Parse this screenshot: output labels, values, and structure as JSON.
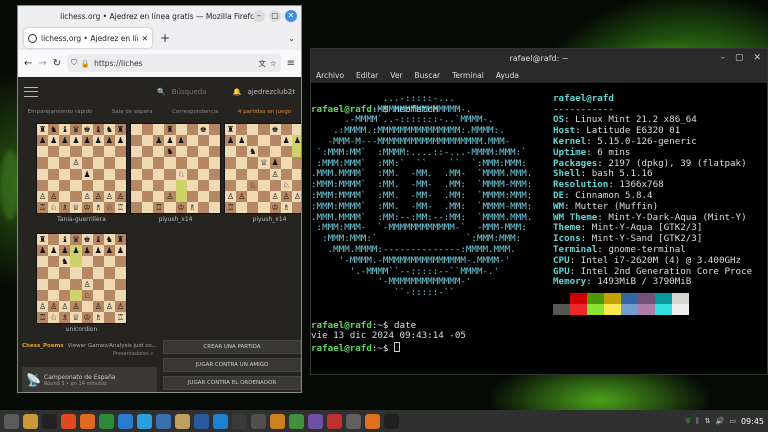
{
  "firefox": {
    "window_title": "lichess.org • Ajedrez en línea gratis — Mozilla Firefox",
    "tab_title": "lichess.org • Ajedrez en líne",
    "new_tab": "+",
    "url": "https://liches",
    "lichess": {
      "search_placeholder": "Búsqueda",
      "username": "ajedrezclub2t",
      "nav": [
        "Emparejamiento rápido",
        "Sala de espera",
        "Correspondencia",
        "4 partidas en juego"
      ],
      "boards": [
        {
          "name": "Tania-guerrillera",
          "position": [
            "rnbqkbnr",
            "pppppppp",
            "........",
            "...P....",
            "....p...",
            "........",
            "PP..PPPP",
            "RNBQKBNR"
          ],
          "highlights": []
        },
        {
          "name": "piyush_x14",
          "position": [
            "...r..k.",
            "..ppp...",
            "...n....",
            "........",
            "....N...",
            "........",
            "...P....",
            "..R.KB.."
          ],
          "highlights": [
            "5,4",
            "6,4"
          ]
        },
        {
          "name": "piyush_x14",
          "position": [
            "r...k..r",
            "pp...ppp",
            "..n.....",
            "...Qp...",
            "....P...",
            "..N..N..",
            "PP..PPPP",
            "R...KB.R"
          ],
          "highlights": [
            "1,6",
            "2,6"
          ]
        },
        {
          "name": "unicordion",
          "position": [
            "r.bqkbnr",
            "pppppppp",
            "..n.....",
            "........",
            "....P...",
            "....N...",
            "PPPP.PPP",
            "RNBQKB.R"
          ],
          "highlights": [
            "1,3",
            "2,3",
            "5,3"
          ]
        }
      ],
      "streamer": "Chess_Poems",
      "streamer_status": "Viewer Games/Analysis just co...",
      "presentadores": "Presentadores »",
      "buttons": [
        "CREAR UNA PARTIDA",
        "JUGAR CONTRA UN AMIGO",
        "JUGAR CONTRA EL ORDENADOR"
      ],
      "tournament_name": "Campeonato de España",
      "tournament_round": "Round 3 • en 14 minutos"
    }
  },
  "terminal": {
    "title": "rafael@rafd: ~",
    "menu": [
      "Archivo",
      "Editar",
      "Ver",
      "Buscar",
      "Terminal",
      "Ayuda"
    ],
    "prompt": "rafael@rafd",
    "prompt_suffix": ":~$ ",
    "cmd1": "neofetch",
    "logo_lines": [
      "             ...-:::::-...",
      "          .-MMMMMMMMMMMMMMM-.",
      "      .-MMMM`..-:::::::-..`MMMM-.",
      "    .:MMMM.:MMMMMMMMMMMMMMM:.MMMM:.",
      "   -MMM-M---MMMMMMMMMMMMMMMMMMM.MMM-",
      " `:MMM:MM`  :MMMM:....::-...-MMMM:MMM:`",
      " :MMM:MMM`  :MM:`  ``    ``  `:MMM:MMM:",
      ".MMM.MMMM`  :MM.  -MM.  .MM-  `MMMM.MMM.",
      ":MMM:MMMM`  :MM.  -MM-  .MM:  `MMMM-MMM:",
      ":MMM:MMMM`  :MM.  -MM-  .MM:  `MMMM:MMM:",
      ":MMM:MMMM`  :MM.  -MM-  .MM:  `MMMM-MMM:",
      ".MMM.MMMM`  :MM:--:MM:--:MM:  `MMMM.MMM.",
      " :MMM:MMM-  `-MMMMMMMMMMMM-`  -MMM-MMM:",
      "  :MMM:MMM:`                `:MMM:MMM:",
      "   .MMM.MMMM:--------------:MMMM.MMM.",
      "     '-MMMM.-MMMMMMMMMMMMMMM-.MMMM-'",
      "       '.-MMMM``--:::::--``MMMM-.'",
      "            '-MMMMMMMMMMMMM-'",
      "               ``-:::::-``"
    ],
    "header": "rafael@rafd",
    "separator": "-----------",
    "info": [
      {
        "k": "OS",
        "v": "Linux Mint 21.2 x86_64"
      },
      {
        "k": "Host",
        "v": "Latitude E6320 01"
      },
      {
        "k": "Kernel",
        "v": "5.15.0-126-generic"
      },
      {
        "k": "Uptime",
        "v": "6 mins"
      },
      {
        "k": "Packages",
        "v": "2197 (dpkg), 39 (flatpak)"
      },
      {
        "k": "Shell",
        "v": "bash 5.1.16"
      },
      {
        "k": "Resolution",
        "v": "1366x768"
      },
      {
        "k": "DE",
        "v": "Cinnamon 5.8.4"
      },
      {
        "k": "WM",
        "v": "Mutter (Muffin)"
      },
      {
        "k": "WM Theme",
        "v": "Mint-Y-Dark-Aqua (Mint-Y)"
      },
      {
        "k": "Theme",
        "v": "Mint-Y-Aqua [GTK2/3]"
      },
      {
        "k": "Icons",
        "v": "Mint-Y-Sand [GTK2/3]"
      },
      {
        "k": "Terminal",
        "v": "gnome-terminal"
      },
      {
        "k": "CPU",
        "v": "Intel i7-2620M (4) @ 3.400GHz"
      },
      {
        "k": "GPU",
        "v": "Intel 2nd Generation Core Proce"
      },
      {
        "k": "Memory",
        "v": "1493MiB / 3790MiB"
      }
    ],
    "palette": [
      "#000000",
      "#cc0000",
      "#4e9a06",
      "#c4a000",
      "#3465a4",
      "#75507b",
      "#06989a",
      "#d3d7cf",
      "#555753",
      "#ef2929",
      "#8ae234",
      "#fce94f",
      "#729fcf",
      "#ad7fa8",
      "#34e2e2",
      "#eeeeec"
    ],
    "cmd2": "date",
    "date_output": "vie 13 dic 2024 09:43:14 -05"
  },
  "taskbar": {
    "clock": "09:45",
    "apps": [
      {
        "icon": "mint-menu-icon",
        "color": "#5a5a5a"
      },
      {
        "icon": "files-icon",
        "color": "#c89a3a"
      },
      {
        "icon": "terminal-icon",
        "color": "#222222"
      },
      {
        "icon": "brave-icon",
        "color": "#e04a20"
      },
      {
        "icon": "firefox-icon",
        "color": "#e06a20"
      },
      {
        "icon": "chrome-icon",
        "color": "#2a8a3a"
      },
      {
        "icon": "edge-icon",
        "color": "#2a7ad0"
      },
      {
        "icon": "telegram-icon",
        "color": "#2aa0e0"
      },
      {
        "icon": "text-editor-icon",
        "color": "#3a70b0"
      },
      {
        "icon": "files-icon",
        "color": "#c0a060"
      },
      {
        "icon": "virtualbox-icon",
        "color": "#2a5aa0"
      },
      {
        "icon": "vscode-icon",
        "color": "#2080d0"
      },
      {
        "icon": "terminal-icon",
        "color": "#3a3a3a"
      },
      {
        "icon": "github-icon",
        "color": "#505050"
      },
      {
        "icon": "media-player-icon",
        "color": "#d08020"
      },
      {
        "icon": "photo-icon",
        "color": "#409040"
      },
      {
        "icon": "audio-icon",
        "color": "#7050a0"
      },
      {
        "icon": "screenshot-icon",
        "color": "#c03030"
      },
      {
        "icon": "settings-icon",
        "color": "#606060"
      },
      {
        "icon": "firefox-icon",
        "color": "#e07020"
      },
      {
        "icon": "terminal-icon",
        "color": "#202020"
      }
    ]
  }
}
